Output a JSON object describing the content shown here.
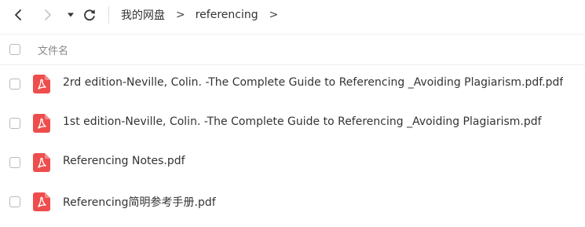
{
  "toolbar": {
    "back_icon": "chevron-left-icon",
    "forward_icon": "chevron-right-icon",
    "dropdown_icon": "caret-down-icon",
    "refresh_icon": "refresh-icon"
  },
  "breadcrumb": {
    "items": [
      "我的网盘",
      "referencing"
    ],
    "separator": ">"
  },
  "list_header": {
    "name_column": "文件名"
  },
  "files": [
    {
      "name": "2rd edition-Neville, Colin. -The Complete Guide to Referencing _Avoiding Plagiarism.pdf.pdf",
      "icon": "pdf-file-icon"
    },
    {
      "name": "1st edition-Neville, Colin. -The Complete Guide to Referencing _Avoiding Plagiarism.pdf",
      "icon": "pdf-file-icon"
    },
    {
      "name": "Referencing Notes.pdf",
      "icon": "pdf-file-icon"
    },
    {
      "name": "Referencing简明参考手册.pdf",
      "icon": "pdf-file-icon"
    }
  ],
  "colors": {
    "pdf_icon": "#ef4d4d",
    "text": "#333333",
    "header_text": "#888888",
    "checkbox_border": "#b9b9b9",
    "nav_disabled": "#c8c8c8"
  }
}
